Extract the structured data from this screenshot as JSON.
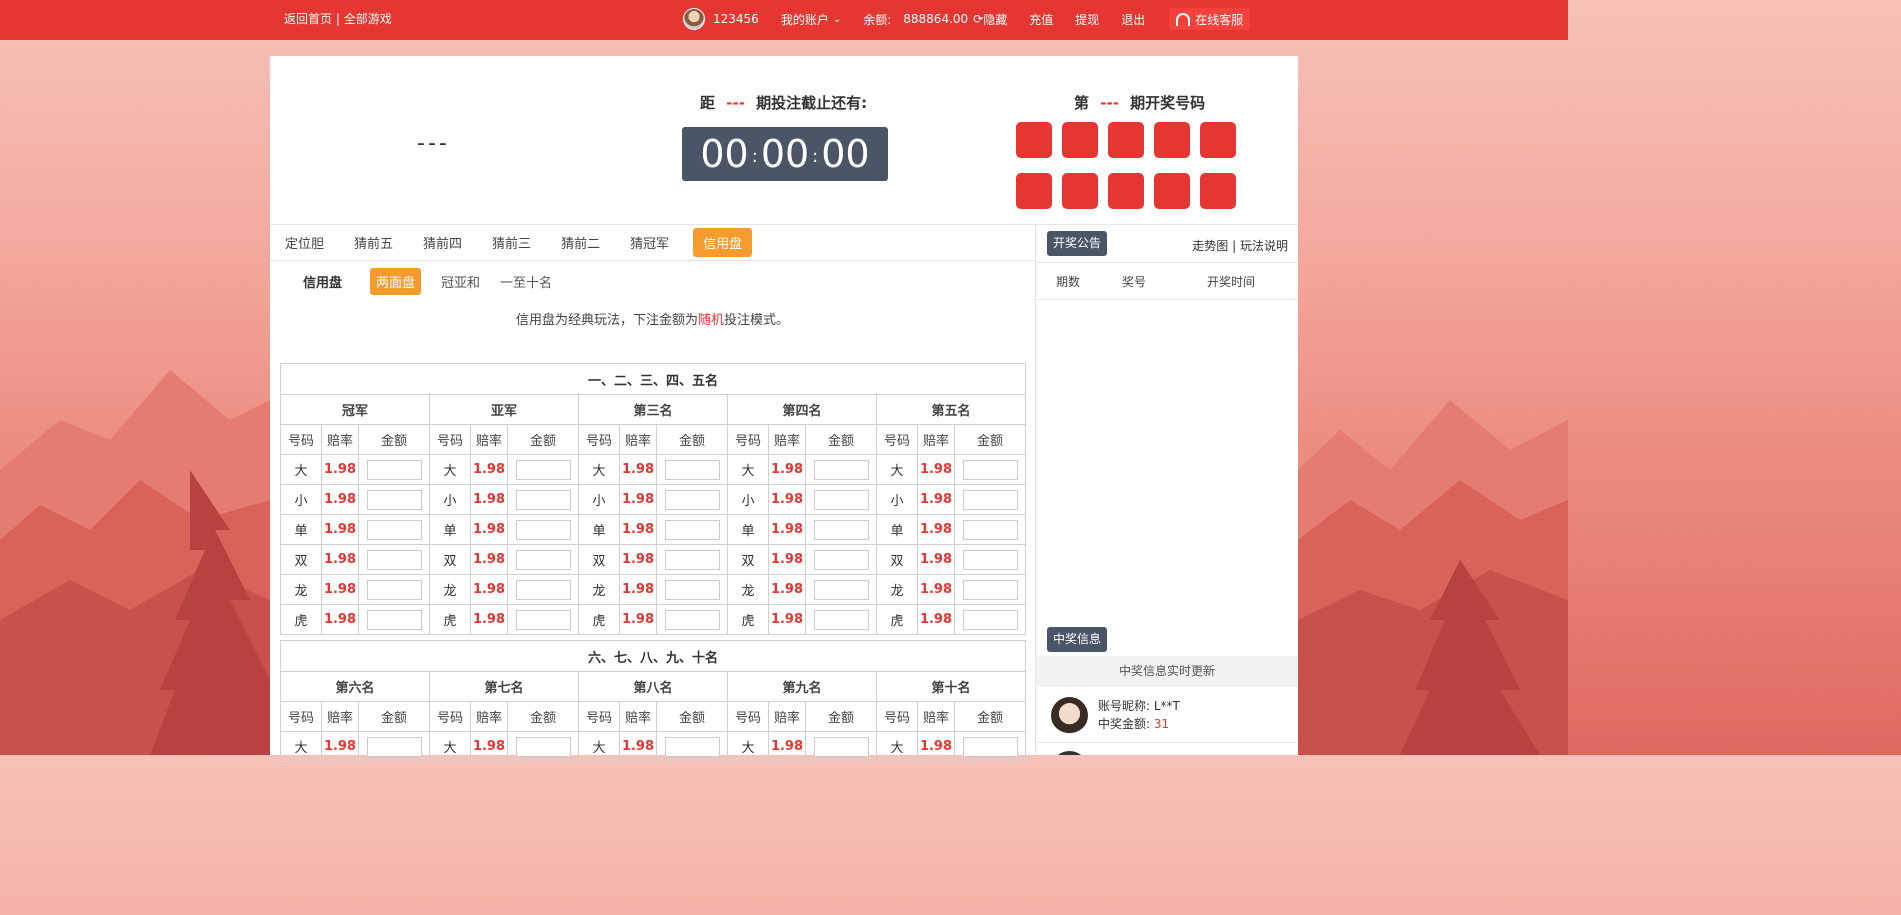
{
  "topbar": {
    "home": "返回首页",
    "sep": " | ",
    "all_games": "全部游戏",
    "username": "123456",
    "my_account": "我的账户",
    "balance_label": "余额:",
    "balance_value": "888864.00",
    "hide": "隐藏",
    "recharge": "充值",
    "withdraw": "提现",
    "logout": "退出",
    "customer_service": "在线客服"
  },
  "draw": {
    "current_period": "---",
    "countdown_prefix": "距",
    "countdown_period": "---",
    "countdown_suffix": "期投注截止还有:",
    "hh": "00",
    "mm": "00",
    "ss": "00",
    "colon": ":",
    "result_prefix": "第",
    "result_period": "---",
    "result_suffix": "期开奖号码",
    "balls": [
      "",
      "",
      "",
      "",
      "",
      "",
      "",
      "",
      "",
      ""
    ]
  },
  "tabs": [
    "定位胆",
    "猜前五",
    "猜前四",
    "猜前三",
    "猜前二",
    "猜冠军",
    "信用盘"
  ],
  "active_tab": "信用盘",
  "subtabs": {
    "label": "信用盘",
    "items": [
      "两面盘",
      "冠亚和",
      "一至十名"
    ],
    "active": "两面盘"
  },
  "description": {
    "pre": "信用盘为经典玩法，下注金额为",
    "highlight": "随机",
    "post": "投注模式。"
  },
  "tables": [
    {
      "caption": "一、二、三、四、五名",
      "groups": [
        "冠军",
        "亚军",
        "第三名",
        "第四名",
        "第五名"
      ],
      "header": [
        "号码",
        "赔率",
        "金额"
      ],
      "rows": [
        {
          "code": "大",
          "odds": "1.98"
        },
        {
          "code": "小",
          "odds": "1.98"
        },
        {
          "code": "单",
          "odds": "1.98"
        },
        {
          "code": "双",
          "odds": "1.98"
        },
        {
          "code": "龙",
          "odds": "1.98"
        },
        {
          "code": "虎",
          "odds": "1.98"
        }
      ]
    },
    {
      "caption": "六、七、八、九、十名",
      "groups": [
        "第六名",
        "第七名",
        "第八名",
        "第九名",
        "第十名"
      ],
      "header": [
        "号码",
        "赔率",
        "金额"
      ],
      "rows": [
        {
          "code": "大",
          "odds": "1.98"
        }
      ]
    }
  ],
  "announcement": {
    "title": "开奖公告",
    "trend": "走势图",
    "sep": " | ",
    "rules": "玩法说明",
    "columns": [
      "期数",
      "奖号",
      "开奖时间"
    ]
  },
  "winners": {
    "title": "中奖信息",
    "subtitle": "中奖信息实时更新",
    "items": [
      {
        "name_label": "账号昵称:",
        "name": "L**T",
        "amount_label": "中奖金额:",
        "amount": "31"
      }
    ]
  },
  "colors": {
    "brand_red": "#e63631",
    "accent_orange": "#f79b2c",
    "dark_slate": "#4a5568"
  }
}
